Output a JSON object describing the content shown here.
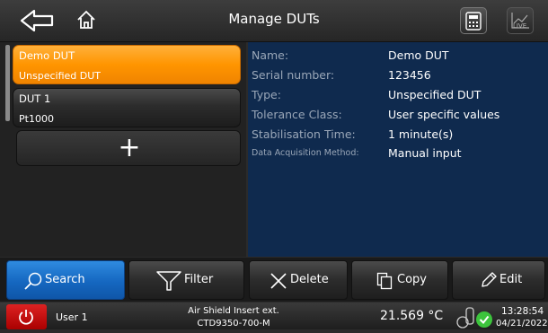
{
  "header": {
    "back_icon": "back-arrow-icon",
    "home_icon": "home-icon",
    "title": "Manage DUTs",
    "calculator_icon": "calculator-icon",
    "live_label": "LIVE"
  },
  "dut_list": [
    {
      "name": "Demo DUT",
      "type": "Unspecified DUT",
      "selected": true
    },
    {
      "name": "DUT 1",
      "type": "Pt1000",
      "selected": false
    }
  ],
  "add_button": {
    "label": "+"
  },
  "details": {
    "name_label": "Name:",
    "name_value": "Demo DUT",
    "serial_label": "Serial number:",
    "serial_value": "123456",
    "type_label": "Type:",
    "type_value": "Unspecified DUT",
    "tolerance_label": "Tolerance Class:",
    "tolerance_value": "User specific values",
    "stabilisation_label": "Stabilisation Time:",
    "stabilisation_value": "1 minute(s)",
    "acquisition_label": "Data Acquisition Method:",
    "acquisition_value": "Manual input"
  },
  "toolbar": {
    "search": "Search",
    "filter": "Filter",
    "delete": "Delete",
    "copy": "Copy",
    "edit": "Edit"
  },
  "status_bar": {
    "user": "User 1",
    "device_line1": "Air Shield Insert ext.",
    "device_line2": "CTD9350-700-M",
    "temperature": "21.569 °C",
    "time": "13:28:54",
    "date": "04/21/2022"
  },
  "colors": {
    "accent_orange": "#ff9500",
    "selected_blue": "#1567c0",
    "detail_background": "#0f2a4e",
    "power_red": "#cc1111",
    "status_green": "#3cc43c"
  }
}
